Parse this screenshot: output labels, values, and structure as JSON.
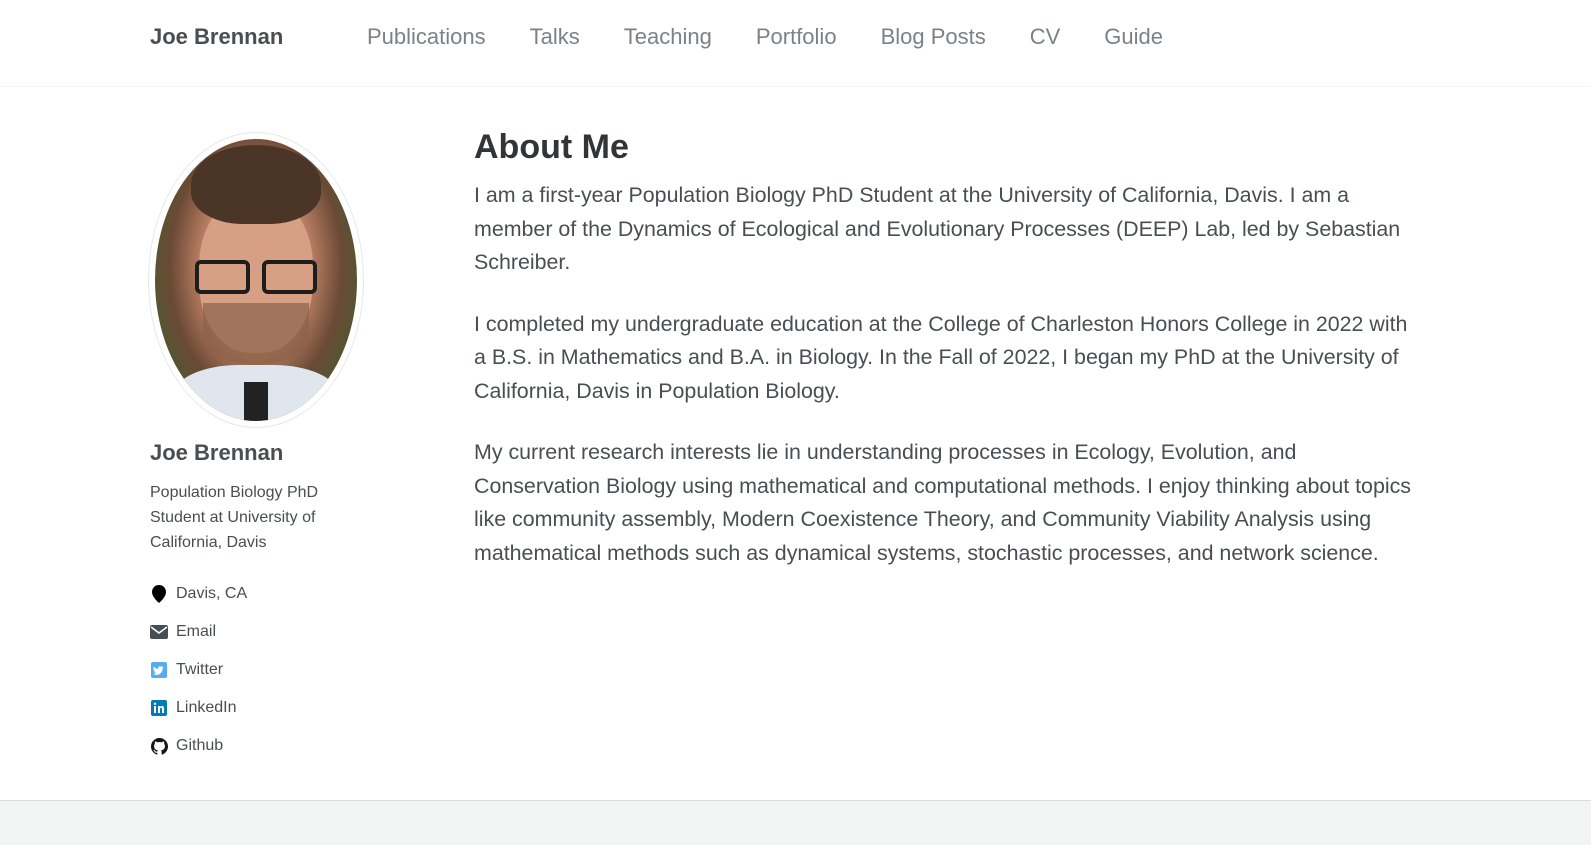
{
  "header": {
    "site_title": "Joe Brennan",
    "nav": [
      {
        "label": "Publications"
      },
      {
        "label": "Talks"
      },
      {
        "label": "Teaching"
      },
      {
        "label": "Portfolio"
      },
      {
        "label": "Blog Posts"
      },
      {
        "label": "CV"
      },
      {
        "label": "Guide"
      }
    ]
  },
  "sidebar": {
    "name": "Joe Brennan",
    "bio": "Population Biology PhD Student at University of California, Davis",
    "links": [
      {
        "icon": "location-pin-icon",
        "label": "Davis, CA",
        "color": "#000000"
      },
      {
        "icon": "envelope-icon",
        "label": "Email",
        "color": "#494e52"
      },
      {
        "icon": "twitter-icon",
        "label": "Twitter",
        "color": "#55acee"
      },
      {
        "icon": "linkedin-icon",
        "label": "LinkedIn",
        "color": "#007bb6"
      },
      {
        "icon": "github-icon",
        "label": "Github",
        "color": "#171516"
      }
    ]
  },
  "main": {
    "title": "About Me",
    "paragraphs": [
      "I am a first-year Population Biology PhD Student at the University of California, Davis. I am a member of the Dynamics of Ecological and Evolutionary Processes (DEEP) Lab, led by Sebastian Schreiber.",
      "I completed my undergraduate education at the College of Charleston Honors College in 2022 with a B.S. in Mathematics and B.A. in Biology. In the Fall of 2022, I began my PhD at the University of California, Davis in Population Biology.",
      "My current research interests lie in understanding processes in Ecology, Evolution, and Conservation Biology using mathematical and computational methods. I enjoy thinking about topics like community assembly, Modern Coexistence Theory, and Community Viability Analysis using mathematical methods such as dynamical systems, stochastic processes, and network science."
    ]
  }
}
